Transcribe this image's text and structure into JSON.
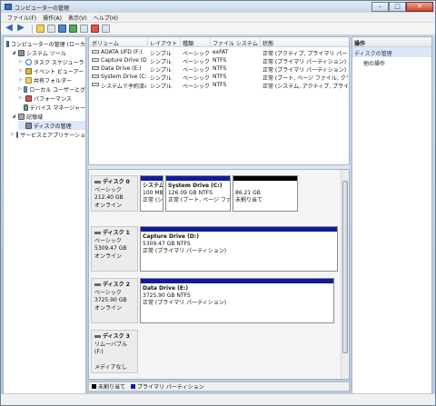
{
  "window": {
    "title": "コンピューターの管理",
    "controls": [
      "–",
      "□",
      "✕"
    ]
  },
  "menu": [
    "ファイル(F)",
    "操作(A)",
    "表示(V)",
    "ヘルプ(H)"
  ],
  "toolbar_icons": [
    "back-arrow-icon",
    "forward-arrow-icon",
    "up-folder-icon",
    "properties-icon",
    "help-icon",
    "refresh-icon",
    "export-icon",
    "console-icon",
    "settings-icon"
  ],
  "tree": [
    {
      "label": "コンピューターの管理 (ローカ",
      "exp": "",
      "icon": "pc",
      "level": 0
    },
    {
      "label": "システム ツール",
      "exp": "◢",
      "icon": "tool",
      "level": 1
    },
    {
      "label": "タスク スケジューラ",
      "exp": "▷",
      "icon": "clock",
      "level": 2
    },
    {
      "label": "イベント ビューアー",
      "exp": "▷",
      "icon": "event",
      "level": 2
    },
    {
      "label": "共有フォルダー",
      "exp": "▷",
      "icon": "folder",
      "level": 2
    },
    {
      "label": "ローカル ユーザーとグ",
      "exp": "▷",
      "icon": "users",
      "level": 2
    },
    {
      "label": "パフォーマンス",
      "exp": "▷",
      "icon": "perf",
      "level": 2
    },
    {
      "label": "デバイス マネージャー",
      "exp": "",
      "icon": "dev",
      "level": 2
    },
    {
      "label": "記憶域",
      "exp": "◢",
      "icon": "store",
      "level": 1
    },
    {
      "label": "ディスクの管理",
      "exp": "",
      "icon": "disk",
      "level": 2,
      "selected": true
    },
    {
      "label": "サービスとアプリケーショ",
      "exp": "▷",
      "icon": "svc",
      "level": 1
    }
  ],
  "volume_table": {
    "headers": [
      "ボリューム",
      "レイアウト",
      "種類",
      "ファイル システム",
      "状態"
    ],
    "rows": [
      [
        "ADATA UFD (F:)",
        "シンプル",
        "ベーシック",
        "exFAT",
        "正常 (アクティブ, プライマリ パーテ"
      ],
      [
        "Capture Drive (D:)",
        "シンプル",
        "ベーシック",
        "NTFS",
        "正常 (プライマリ パーティション)"
      ],
      [
        "Data Drive (E:)",
        "シンプル",
        "ベーシック",
        "NTFS",
        "正常 (プライマリ パーティション)"
      ],
      [
        "System Drive (C:)",
        "シンプル",
        "ベーシック",
        "NTFS",
        "正常 (ブート, ページ ファイル, クラ"
      ],
      [
        "システムで予約済み",
        "シンプル",
        "ベーシック",
        "NTFS",
        "正常 (システム, アクティブ, プライベ"
      ]
    ]
  },
  "disks": [
    {
      "name": "ディスク 0",
      "type": "ベーシック",
      "size": "212.40 GB",
      "status": "オンライン",
      "parts": [
        {
          "name": "システム",
          "l2": "100 MB",
          "l3": "正常 (シ",
          "bar": "blue"
        },
        {
          "name": "System Drive  (C:)",
          "l2": "126.09 GB NTFS",
          "l3": "正常 (ブート, ページ ファ",
          "bar": "blue"
        },
        {
          "name": "",
          "l2": "86.21 GB",
          "l3": "未割り当て",
          "bar": "black"
        }
      ]
    },
    {
      "name": "ディスク 1",
      "type": "ベーシック",
      "size": "5309.47 GB",
      "status": "オンライン",
      "parts": [
        {
          "name": "Capture Drive  (D:)",
          "l2": "5309.47 GB NTFS",
          "l3": "正常 (プライマリ パーティション)",
          "bar": "blue"
        }
      ]
    },
    {
      "name": "ディスク 2",
      "type": "ベーシック",
      "size": "3725.90 GB",
      "status": "オンライン",
      "parts": [
        {
          "name": "Data Drive  (E:)",
          "l2": "3725.90 GB NTFS",
          "l3": "正常 (プライマリ パーティション)",
          "bar": "blue"
        }
      ]
    },
    {
      "name": "ディスク 3",
      "type": "リムーバブル (F:)",
      "size": "",
      "status": "メディアなし",
      "parts": []
    }
  ],
  "legend": [
    {
      "label": "未割り当て",
      "color": "#000000"
    },
    {
      "label": "プライマリ パーティション",
      "color": "#101c9b"
    }
  ],
  "actions": {
    "header": "操作",
    "section": "ディスクの管理",
    "item": "他の操作"
  }
}
